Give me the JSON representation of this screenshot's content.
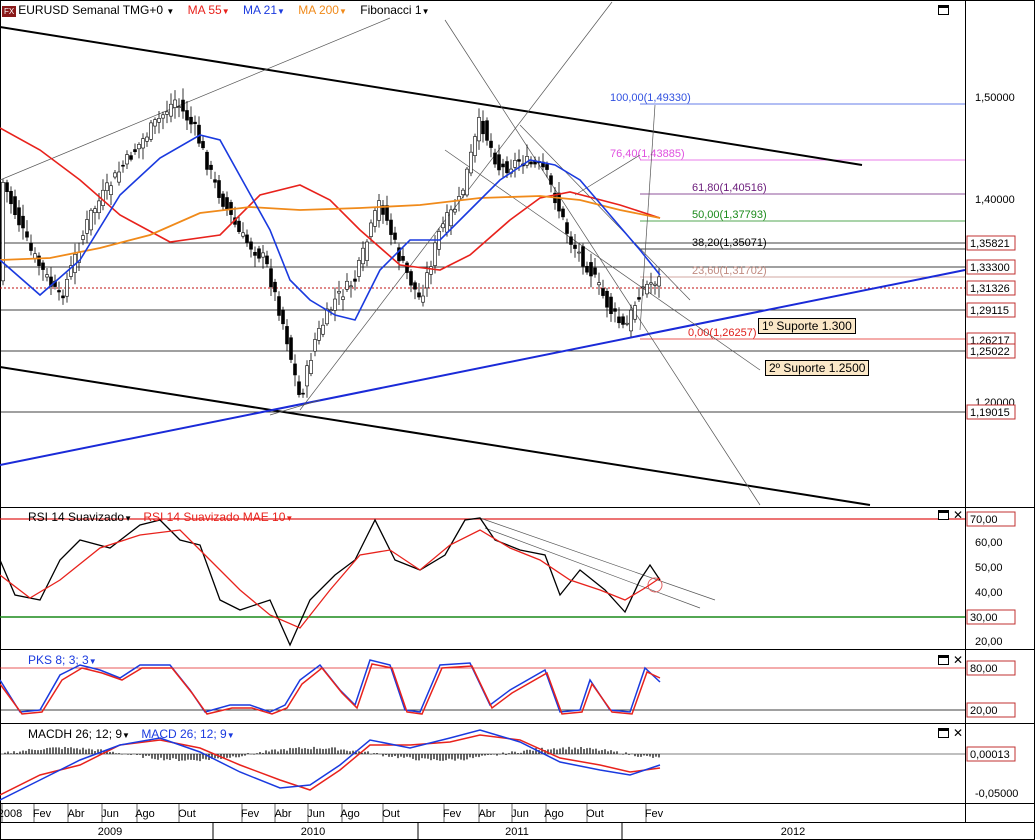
{
  "header": {
    "icon_text": "FX",
    "symbol": "EURUSD Semanal TMG+0",
    "ma55": "MA 55",
    "ma21": "MA 21",
    "ma200": "MA 200",
    "fib": "Fibonacci 1",
    "colors": {
      "ma55": "#e8221c",
      "ma21": "#1a3adf",
      "ma200": "#f08a1a"
    }
  },
  "panels": {
    "rsi_title1": "RSI 14 Suavizado",
    "rsi_title2": "RSI 14 Suavizado MAE 10",
    "pks_title": "PKS 8; 3; 3",
    "macd_title1": "MACDH 26; 12; 9",
    "macd_title2": "MACD 26; 12; 9"
  },
  "price_axis": {
    "ticks": [
      "1,50000",
      "1,40000",
      "1,20000"
    ],
    "boxes": [
      "1,35821",
      "1,33300",
      "1,31326",
      "1,29115",
      "1,26217",
      "1,25022",
      "1,19015"
    ]
  },
  "rsi_axis": {
    "ticks": [
      "60,00",
      "50,00",
      "40,00",
      "20,00"
    ],
    "boxes": [
      "70,00",
      "30,00"
    ]
  },
  "pks_axis": {
    "boxes": [
      "80,00",
      "20,00"
    ]
  },
  "macd_axis": {
    "ticks": [
      "-0,05000"
    ],
    "boxes": [
      "0,00013"
    ]
  },
  "fib_levels": [
    {
      "label": "100,00(1,49330)",
      "color": "#3050e0"
    },
    {
      "label": "76,40(1,43885)",
      "color": "#e050e0"
    },
    {
      "label": "61,80(1,40516)",
      "color": "#6a1a7a"
    },
    {
      "label": "50,00(1,37793)",
      "color": "#1a8a1a"
    },
    {
      "label": "38,20(1,35071)",
      "color": "#000000"
    },
    {
      "label": "23,60(1,31702)",
      "color": "#c08a80"
    },
    {
      "label": "0,00(1,26257)",
      "color": "#e0201c"
    }
  ],
  "annotations": [
    "1º Suporte 1.300",
    "2º Suporte 1.2500"
  ],
  "x_axis": {
    "months": [
      "2008",
      "Fev",
      "Abr",
      "Jun",
      "Ago",
      "Out",
      "Fev",
      "Abr",
      "Jun",
      "Ago",
      "Out",
      "Fev",
      "Abr",
      "Jun",
      "Ago",
      "Out",
      "Fev"
    ],
    "years": [
      "2009",
      "2010",
      "2011",
      "2012"
    ]
  },
  "chart_data": {
    "type": "line",
    "title": "EURUSD Semanal TMG+0",
    "series": [
      {
        "name": "EURUSD",
        "kind": "candlestick",
        "x": [
          "2009-02",
          "2009-05",
          "2009-08",
          "2009-11",
          "2010-02",
          "2010-05",
          "2010-06",
          "2010-08",
          "2010-11",
          "2011-01",
          "2011-04",
          "2011-06",
          "2011-08",
          "2011-10",
          "2011-12",
          "2012-01",
          "2012-02"
        ],
        "y": [
          1.28,
          1.35,
          1.43,
          1.5,
          1.37,
          1.23,
          1.19,
          1.3,
          1.41,
          1.29,
          1.48,
          1.44,
          1.43,
          1.37,
          1.3,
          1.27,
          1.32
        ]
      },
      {
        "name": "MA 55",
        "x": [
          "2009-01",
          "2009-06",
          "2009-11",
          "2010-04",
          "2010-09",
          "2011-02",
          "2011-07",
          "2011-11",
          "2012-02"
        ],
        "y": [
          1.43,
          1.33,
          1.41,
          1.4,
          1.36,
          1.33,
          1.4,
          1.39,
          1.38
        ]
      },
      {
        "name": "MA 21",
        "x": [
          "2009-01",
          "2009-04",
          "2009-08",
          "2009-12",
          "2010-04",
          "2010-07",
          "2010-10",
          "2011-02",
          "2011-05",
          "2011-08",
          "2011-11",
          "2012-01",
          "2012-02"
        ],
        "y": [
          1.35,
          1.31,
          1.4,
          1.46,
          1.34,
          1.25,
          1.33,
          1.36,
          1.42,
          1.41,
          1.33,
          1.32,
          1.32
        ]
      },
      {
        "name": "MA 200",
        "x": [
          "2009-01",
          "2009-06",
          "2009-11",
          "2010-04",
          "2010-09",
          "2011-02",
          "2011-07",
          "2011-11",
          "2012-02"
        ],
        "y": [
          1.34,
          1.36,
          1.39,
          1.4,
          1.4,
          1.4,
          1.41,
          1.4,
          1.38
        ]
      }
    ],
    "ylim": [
      1.15,
      1.55
    ],
    "grid": false,
    "legend": "top-left"
  }
}
